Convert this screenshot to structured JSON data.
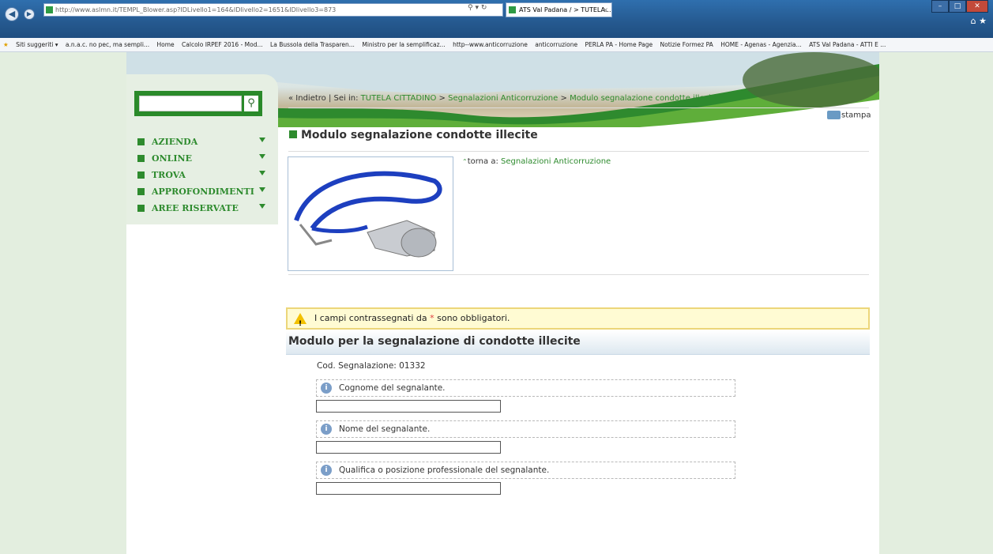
{
  "browser": {
    "address_url": "http://www.aslmn.it/TEMPL_Blower.asp?IDLivello1=164&IDlivello2=1651&IDlivello3=873",
    "address_host": "aslmn.it",
    "tab_title": "ATS Val Padana / > TUTELA...",
    "favorites": [
      "Siti suggeriti ▾",
      "a.n.a.c. no pec, ma sempli...",
      "Home",
      "Calcolo IRPEF 2016 - Mod...",
      "La Bussola della Trasparen...",
      "Ministro per la semplificaz...",
      "http--www.anticorruzione",
      "anticorruzione",
      "PERLA PA - Home Page",
      "Notizie Formez PA",
      "HOME - Agenas - Agenzia...",
      "ATS Val Padana - ATTI E ..."
    ]
  },
  "sidebar": {
    "search_placeholder": "",
    "menu": [
      "AZIENDA",
      "ONLINE",
      "TROVA",
      "APPROFONDIMENTI",
      "AREE RISERVATE"
    ]
  },
  "breadcrumb": {
    "back": "« Indietro",
    "sep": " | Sei in: ",
    "items": [
      "TUTELA CITTADINO",
      "Segnalazioni Anticorruzione",
      "Modulo segnalazione condotte illecite"
    ]
  },
  "print_label": "stampa",
  "page_title": "Modulo segnalazione condotte illecite",
  "back_link": {
    "prefix": "torna a:",
    "label": "Segnalazioni Anticorruzione"
  },
  "warning": {
    "before": "I campi contrassegnati da",
    "star": "*",
    "after": "sono obbligatori."
  },
  "form": {
    "heading": "Modulo per la segnalazione di condotte illecite",
    "code": "Cod. Segnalazione: 01332",
    "fields": [
      {
        "label": "Cognome del segnalante.",
        "value": ""
      },
      {
        "label": "Nome del segnalante.",
        "value": ""
      },
      {
        "label": "Qualifica o posizione professionale del segnalante.",
        "value": ""
      }
    ]
  }
}
